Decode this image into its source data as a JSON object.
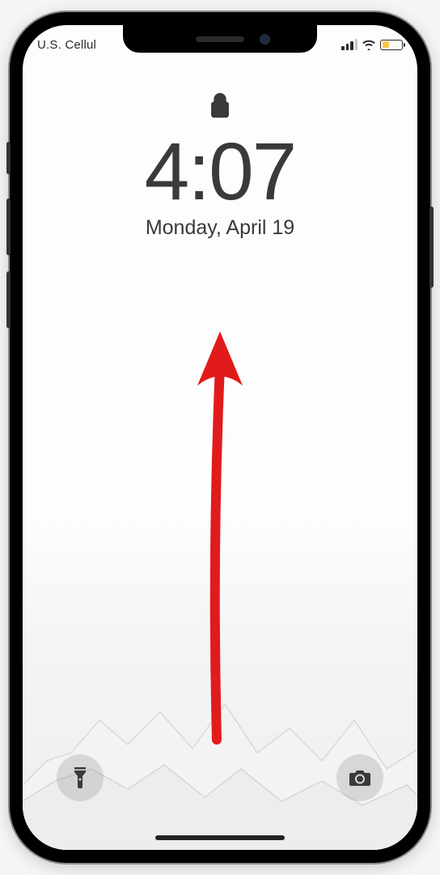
{
  "statusBar": {
    "carrier": "U.S. Cellul",
    "signalBars": 3,
    "wifi": true,
    "batteryLowPowerMode": true,
    "batteryPercent": 35
  },
  "lockScreen": {
    "locked": true,
    "time": "4:07",
    "date": "Monday, April 19"
  },
  "icons": {
    "lock": "lock-icon",
    "flashlight": "flashlight-icon",
    "camera": "camera-icon"
  },
  "annotation": {
    "type": "swipe-up-arrow",
    "color": "#E11B1B"
  }
}
